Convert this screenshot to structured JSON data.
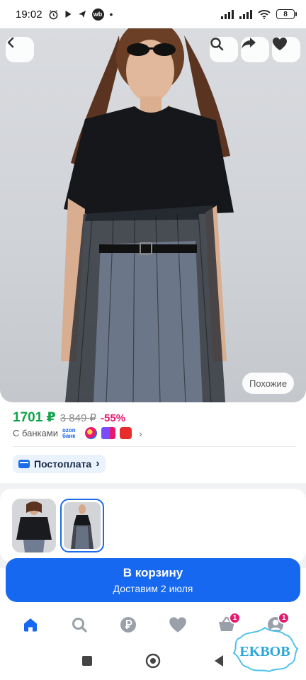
{
  "status_bar": {
    "time": "19:02",
    "battery": "8",
    "icons": [
      "alarm-icon",
      "play-icon",
      "send-icon",
      "wb-app-icon",
      "dots-icon",
      "signal-icon",
      "signal-icon",
      "wifi-icon",
      "battery-icon"
    ],
    "wb_label": "wb"
  },
  "hero": {
    "similar_label": "Похожие",
    "buttons": [
      "back-icon",
      "search-icon",
      "share-icon",
      "heart-icon"
    ]
  },
  "price": {
    "current": "1701 ₽",
    "old": "3 849 ₽",
    "discount": "-55%",
    "current_color": "#10a44a",
    "discount_color": "#e6196e"
  },
  "banks": {
    "label": "С банками",
    "ozon_line1": "ozon",
    "ozon_line2": "банк"
  },
  "postpay": {
    "label": "Постоплата",
    "chevron": "›"
  },
  "cart": {
    "title": "В корзину",
    "subtitle": "Доставим 2 июля",
    "color": "#1768f0"
  },
  "tabbar": {
    "items": [
      {
        "icon": "home-icon",
        "active": true
      },
      {
        "icon": "search-icon"
      },
      {
        "icon": "ruble-icon"
      },
      {
        "icon": "heart-icon"
      },
      {
        "icon": "basket-icon",
        "badge": "1"
      },
      {
        "icon": "profile-icon",
        "badge": "1"
      }
    ],
    "accent": "#1768f0"
  },
  "watermark": {
    "text": "EKBOB"
  }
}
